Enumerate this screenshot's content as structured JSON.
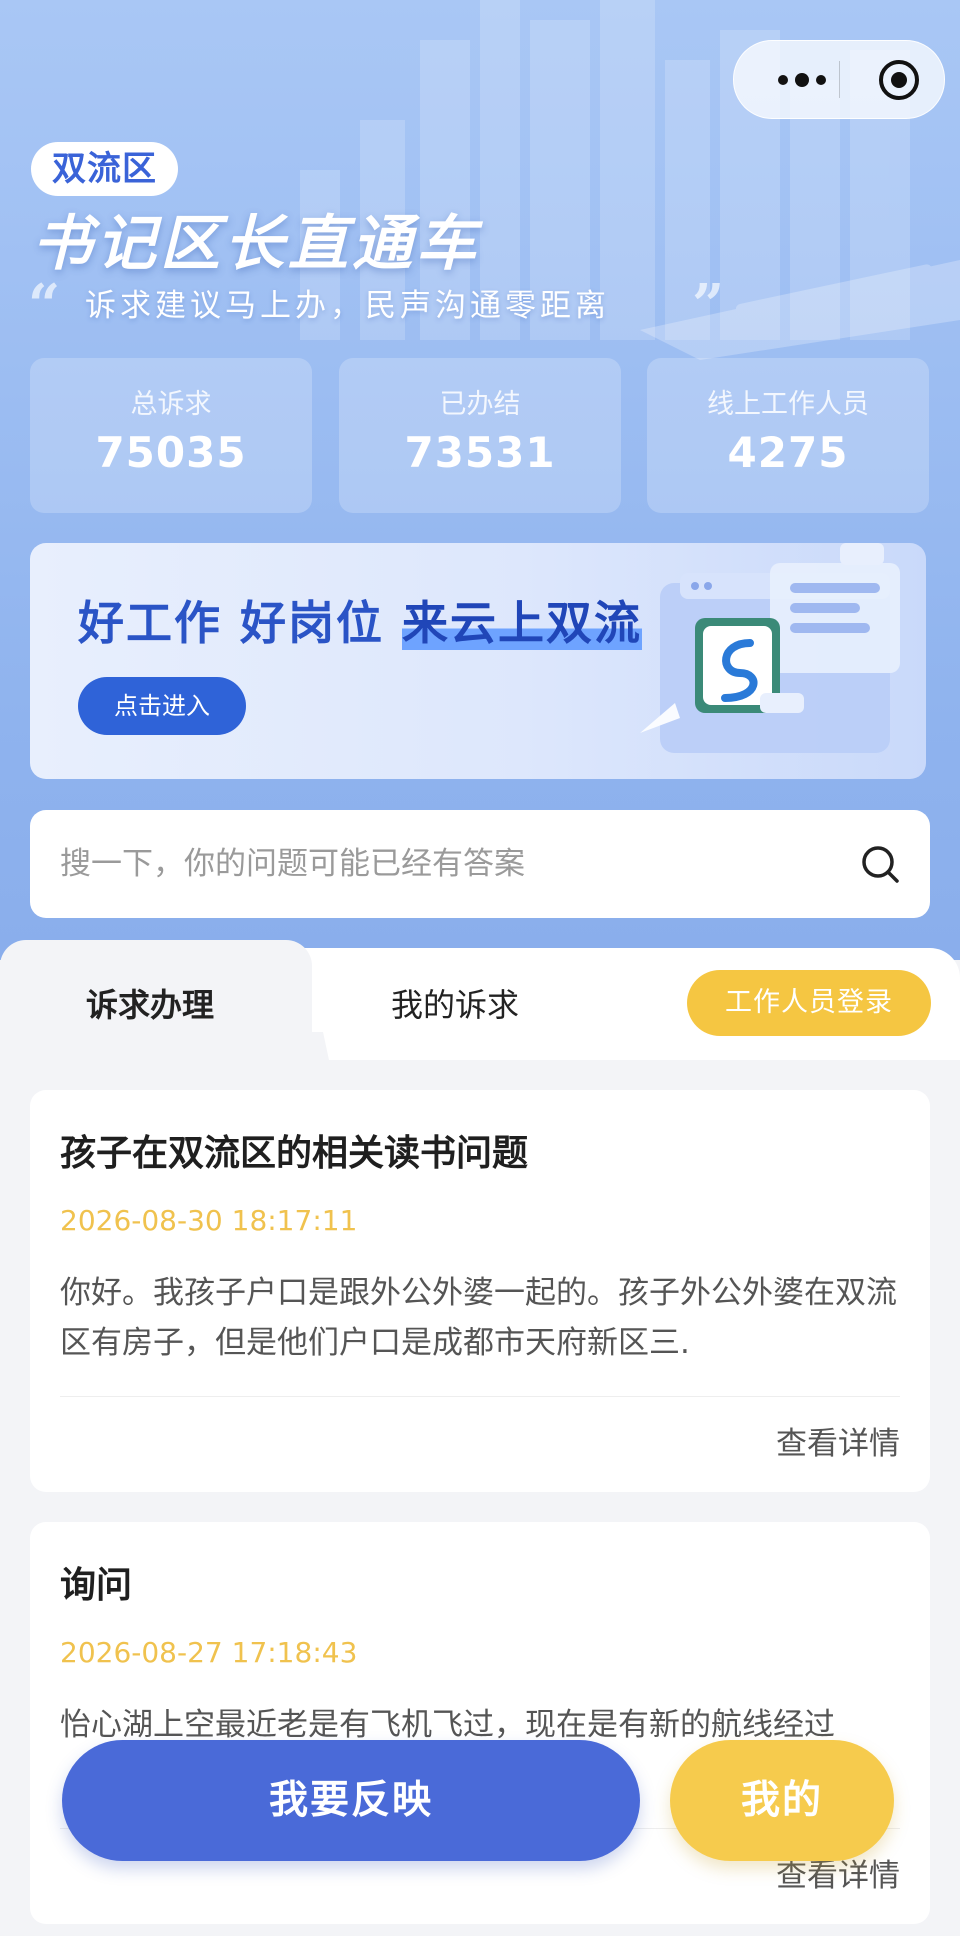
{
  "header": {
    "district": "双流区",
    "title": "书记区长直通车",
    "slogan": "诉求建议马上办，民声沟通零距离",
    "capsule": {
      "more_icon": "more-dots-icon",
      "close_icon": "target-circle-icon"
    }
  },
  "stats": [
    {
      "label": "总诉求",
      "value": "75035"
    },
    {
      "label": "已办结",
      "value": "73531"
    },
    {
      "label": "线上工作人员",
      "value": "4275"
    }
  ],
  "banner": {
    "title_part1": "好工作 好岗位 ",
    "title_part2": "来云上双流",
    "button_label": "点击进入"
  },
  "search": {
    "placeholder": "搜一下，你的问题可能已经有答案",
    "icon": "search-icon"
  },
  "tabs": {
    "items": [
      {
        "label": "诉求办理",
        "active": true
      },
      {
        "label": "我的诉求",
        "active": false
      }
    ],
    "staff_login_label": "工作人员登录"
  },
  "list": [
    {
      "title": "孩子在双流区的相关读书问题",
      "time": "2026-08-30 18:17:11",
      "content": "你好。我孩子户口是跟外公外婆一起的。孩子外公外婆在双流区有房子，但是他们户口是成都市天府新区三.",
      "detail_label": "查看详情"
    },
    {
      "title": "询问",
      "time": "2026-08-27 17:18:43",
      "content": "怡心湖上空最近老是有飞机飞过，现在是有新的航线经过",
      "detail_label": "查看详情"
    }
  ],
  "bottom": {
    "report_label": "我要反映",
    "mine_label": "我的"
  },
  "colors": {
    "hero_blue": "#9cbdf2",
    "accent_blue": "#4a6ad8",
    "accent_yellow": "#f6cb4d",
    "time_yellow": "#f0c24e"
  }
}
